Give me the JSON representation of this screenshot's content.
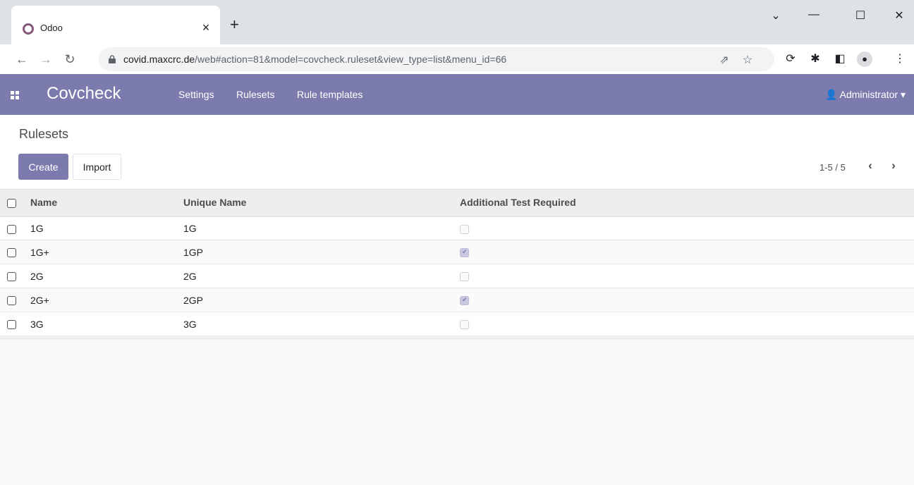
{
  "browser": {
    "tab_title": "Odoo",
    "tab_close": "×",
    "new_tab": "+",
    "window_controls": [
      "⌄",
      "—",
      "☐",
      "✕"
    ],
    "url_host": "covid.maxcrc.de",
    "url_path": "/web#action=81&model=covcheck.ruleset&view_type=list&menu_id=66",
    "icons": [
      "back-icon",
      "forward-icon",
      "reload-icon",
      "lock-icon",
      "share-icon",
      "star-icon",
      "sync-icon",
      "extensions-icon",
      "side-panel-icon",
      "profile-icon",
      "more-icon"
    ]
  },
  "navbar": {
    "brand": "Covcheck",
    "menu": [
      "Settings",
      "Rulesets",
      "Rule templates"
    ],
    "user": "Administrator",
    "accent": "#7c7bad"
  },
  "control": {
    "breadcrumb": "Rulesets",
    "create_label": "Create",
    "import_label": "Import",
    "pager": "1-5 / 5"
  },
  "list": {
    "columns": [
      "Name",
      "Unique Name",
      "Additional Test Required"
    ],
    "rows": [
      {
        "name": "1G",
        "unique_name": "1G",
        "additional_test": false
      },
      {
        "name": "1G+",
        "unique_name": "1GP",
        "additional_test": true
      },
      {
        "name": "2G",
        "unique_name": "2G",
        "additional_test": false
      },
      {
        "name": "2G+",
        "unique_name": "2GP",
        "additional_test": true
      },
      {
        "name": "3G",
        "unique_name": "3G",
        "additional_test": false
      }
    ]
  }
}
